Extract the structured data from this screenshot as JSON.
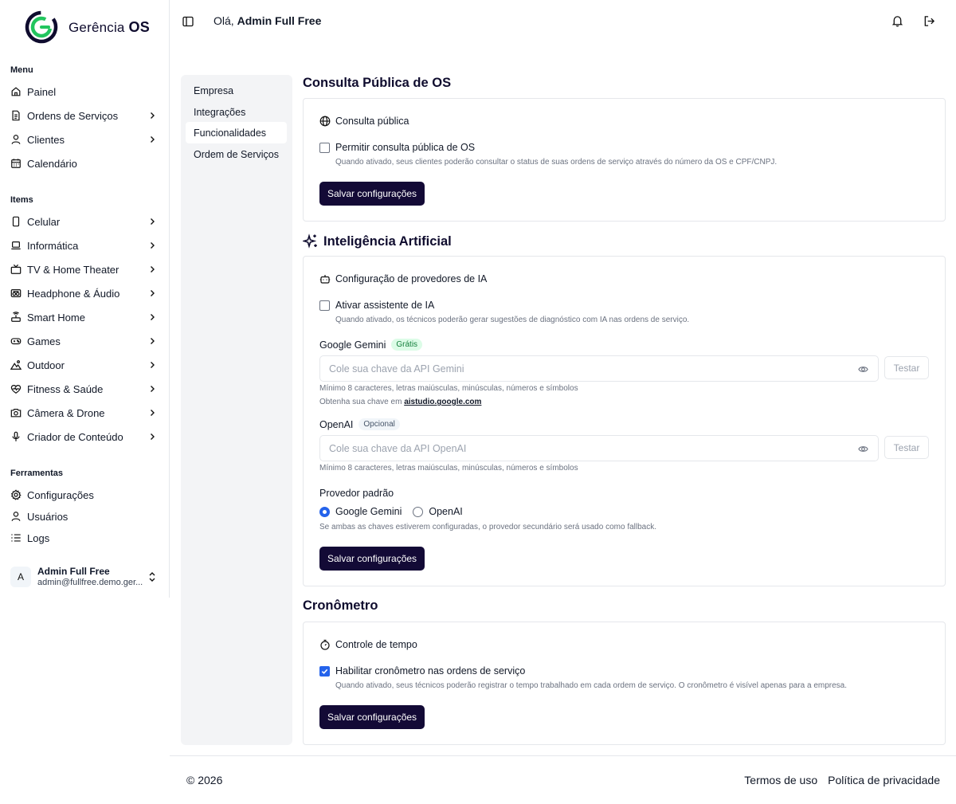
{
  "brand": {
    "name_light": "Gerência",
    "name_bold": "OS"
  },
  "sidebar": {
    "menu_label": "Menu",
    "menu_items": [
      {
        "label": "Painel",
        "icon": "home-icon",
        "chevron": false
      },
      {
        "label": "Ordens de Serviços",
        "icon": "file-icon",
        "chevron": true
      },
      {
        "label": "Clientes",
        "icon": "user-icon",
        "chevron": true
      },
      {
        "label": "Calendário",
        "icon": "calendar-icon",
        "chevron": false
      }
    ],
    "items_label": "Items",
    "items": [
      {
        "label": "Celular",
        "icon": "phone-icon"
      },
      {
        "label": "Informática",
        "icon": "laptop-icon"
      },
      {
        "label": "TV & Home Theater",
        "icon": "tv-icon"
      },
      {
        "label": "Headphone & Áudio",
        "icon": "speaker-icon"
      },
      {
        "label": "Smart Home",
        "icon": "router-icon"
      },
      {
        "label": "Games",
        "icon": "gamepad-icon"
      },
      {
        "label": "Outdoor",
        "icon": "mountain-icon"
      },
      {
        "label": "Fitness & Saúde",
        "icon": "heart-pulse-icon"
      },
      {
        "label": "Câmera & Drone",
        "icon": "camera-icon"
      },
      {
        "label": "Criador de Conteúdo",
        "icon": "mic-icon"
      }
    ],
    "tools_label": "Ferramentas",
    "tools": [
      {
        "label": "Configurações",
        "icon": "gear-icon"
      },
      {
        "label": "Usuários",
        "icon": "user-icon"
      },
      {
        "label": "Logs",
        "icon": "list-icon"
      }
    ],
    "user": {
      "initial": "A",
      "name": "Admin Full Free",
      "email": "admin@fullfree.demo.ger..."
    }
  },
  "header": {
    "greeting_prefix": "Olá, ",
    "user_name": "Admin Full Free"
  },
  "settings_nav": [
    {
      "label": "Empresa",
      "active": false
    },
    {
      "label": "Integrações",
      "active": false
    },
    {
      "label": "Funcionalidades",
      "active": true
    },
    {
      "label": "Ordem de Serviços",
      "active": false
    }
  ],
  "public_query": {
    "title": "Consulta Pública de OS",
    "card_title": "Consulta pública",
    "checkbox_label": "Permitir consulta pública de OS",
    "checkbox_checked": false,
    "help": "Quando ativado, seus clientes poderão consultar o status de suas ordens de serviço através do número da OS e CPF/CNPJ.",
    "save_label": "Salvar configurações"
  },
  "ai": {
    "title": "Inteligência Artificial",
    "card_title": "Configuração de provedores de IA",
    "checkbox_label": "Ativar assistente de IA",
    "checkbox_checked": false,
    "help": "Quando ativado, os técnicos poderão gerar sugestões de diagnóstico com IA nas ordens de serviço.",
    "gemini_label": "Google Gemini",
    "gemini_badge": "Grátis",
    "gemini_placeholder": "Cole sua chave da API Gemini",
    "test_label": "Testar",
    "gemini_hint": "Mínimo 8 caracteres, letras maiúsculas, minúsculas, números e símbolos",
    "gemini_key_prefix": "Obtenha sua chave em ",
    "gemini_key_link": "aistudio.google.com",
    "openai_label": "OpenAI",
    "openai_badge": "Opcional",
    "openai_placeholder": "Cole sua chave da API OpenAI",
    "openai_hint": "Mínimo 8 caracteres, letras maiúsculas, minúsculas, números e símbolos",
    "default_provider_label": "Provedor padrão",
    "provider_options": [
      "Google Gemini",
      "OpenAI"
    ],
    "selected_provider": "Google Gemini",
    "provider_help": "Se ambas as chaves estiverem configuradas, o provedor secundário será usado como fallback.",
    "save_label": "Salvar configurações"
  },
  "timer": {
    "title": "Cronômetro",
    "card_title": "Controle de tempo",
    "checkbox_label": "Habilitar cronômetro nas ordens de serviço",
    "checkbox_checked": true,
    "help": "Quando ativado, seus técnicos poderão registrar o tempo trabalhado em cada ordem de serviço. O cronômetro é visível apenas para a empresa.",
    "save_label": "Salvar configurações"
  },
  "footer": {
    "copyright": "© 2026",
    "terms": "Termos de uso",
    "privacy": "Política de privacidade"
  },
  "colors": {
    "primary": "#130a36",
    "accent_blue": "#2563eb",
    "logo_green": "#22c55e",
    "logo_navy": "#0f0c2e"
  }
}
